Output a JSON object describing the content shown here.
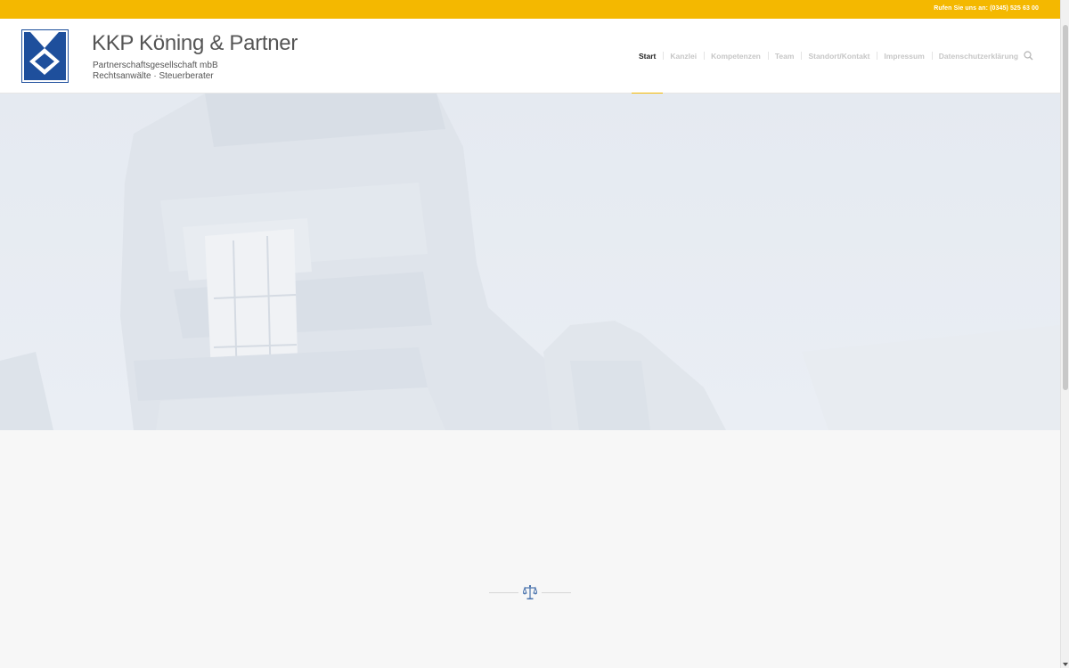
{
  "topbar": {
    "phone_text": "Rufen Sie uns an: (0345) 525 63 00"
  },
  "logo": {
    "title": "KKP Köning & Partner",
    "subtitle_line1": "Partnerschaftsgesellschaft mbB",
    "subtitle_line2": "Rechtsanwälte · Steuerberater"
  },
  "nav": {
    "items": [
      {
        "label": "Start",
        "active": true
      },
      {
        "label": "Kanzlei"
      },
      {
        "label": "Kompetenzen"
      },
      {
        "label": "Team"
      },
      {
        "label": "Standort/Kontakt"
      },
      {
        "label": "Impressum"
      },
      {
        "label": "Datenschutzerklärung"
      }
    ],
    "search_icon": "search-icon"
  },
  "divider": {
    "icon": "scale-icon"
  },
  "colors": {
    "accent": "#f4b800",
    "brand_blue": "#1e4f9c",
    "nav_active": "#222222",
    "nav_inactive": "#c6c6c6"
  }
}
